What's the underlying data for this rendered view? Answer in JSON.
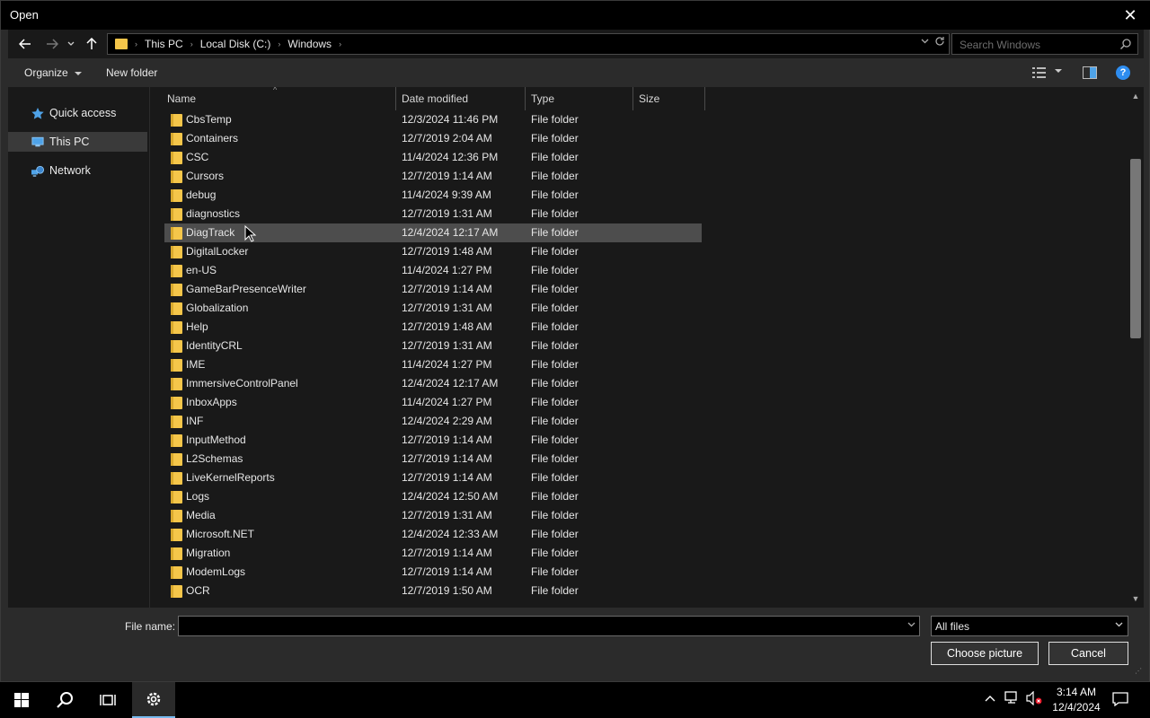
{
  "window": {
    "title": "Open",
    "close_glyph": "✕"
  },
  "navigation": {
    "back_glyph": "←",
    "forward_glyph": "→",
    "recent_glyph": "⌄",
    "up_glyph": "↑",
    "breadcrumbs": [
      "This PC",
      "Local Disk (C:)",
      "Windows"
    ],
    "search_placeholder": "Search Windows"
  },
  "toolbar": {
    "organize_label": "Organize",
    "new_folder_label": "New folder",
    "help_label": "?"
  },
  "sidebar": {
    "items": [
      {
        "label": "Quick access",
        "icon": "star-icon"
      },
      {
        "label": "This PC",
        "icon": "computer-icon",
        "selected": true
      },
      {
        "label": "Network",
        "icon": "network-icon"
      }
    ]
  },
  "file_list": {
    "columns": [
      "Name",
      "Date modified",
      "Type",
      "Size"
    ],
    "rows": [
      {
        "name": "CbsTemp",
        "date": "12/3/2024 11:46 PM",
        "type": "File folder"
      },
      {
        "name": "Containers",
        "date": "12/7/2019 2:04 AM",
        "type": "File folder"
      },
      {
        "name": "CSC",
        "date": "11/4/2024 12:36 PM",
        "type": "File folder"
      },
      {
        "name": "Cursors",
        "date": "12/7/2019 1:14 AM",
        "type": "File folder"
      },
      {
        "name": "debug",
        "date": "11/4/2024 9:39 AM",
        "type": "File folder"
      },
      {
        "name": "diagnostics",
        "date": "12/7/2019 1:31 AM",
        "type": "File folder"
      },
      {
        "name": "DiagTrack",
        "date": "12/4/2024 12:17 AM",
        "type": "File folder",
        "hover": true
      },
      {
        "name": "DigitalLocker",
        "date": "12/7/2019 1:48 AM",
        "type": "File folder"
      },
      {
        "name": "en-US",
        "date": "11/4/2024 1:27 PM",
        "type": "File folder"
      },
      {
        "name": "GameBarPresenceWriter",
        "date": "12/7/2019 1:14 AM",
        "type": "File folder"
      },
      {
        "name": "Globalization",
        "date": "12/7/2019 1:31 AM",
        "type": "File folder"
      },
      {
        "name": "Help",
        "date": "12/7/2019 1:48 AM",
        "type": "File folder"
      },
      {
        "name": "IdentityCRL",
        "date": "12/7/2019 1:31 AM",
        "type": "File folder"
      },
      {
        "name": "IME",
        "date": "11/4/2024 1:27 PM",
        "type": "File folder"
      },
      {
        "name": "ImmersiveControlPanel",
        "date": "12/4/2024 12:17 AM",
        "type": "File folder"
      },
      {
        "name": "InboxApps",
        "date": "11/4/2024 1:27 PM",
        "type": "File folder"
      },
      {
        "name": "INF",
        "date": "12/4/2024 2:29 AM",
        "type": "File folder"
      },
      {
        "name": "InputMethod",
        "date": "12/7/2019 1:14 AM",
        "type": "File folder"
      },
      {
        "name": "L2Schemas",
        "date": "12/7/2019 1:14 AM",
        "type": "File folder"
      },
      {
        "name": "LiveKernelReports",
        "date": "12/7/2019 1:14 AM",
        "type": "File folder"
      },
      {
        "name": "Logs",
        "date": "12/4/2024 12:50 AM",
        "type": "File folder"
      },
      {
        "name": "Media",
        "date": "12/7/2019 1:31 AM",
        "type": "File folder"
      },
      {
        "name": "Microsoft.NET",
        "date": "12/4/2024 12:33 AM",
        "type": "File folder"
      },
      {
        "name": "Migration",
        "date": "12/7/2019 1:14 AM",
        "type": "File folder"
      },
      {
        "name": "ModemLogs",
        "date": "12/7/2019 1:14 AM",
        "type": "File folder"
      },
      {
        "name": "OCR",
        "date": "12/7/2019 1:50 AM",
        "type": "File folder"
      }
    ]
  },
  "footer": {
    "file_name_label": "File name:",
    "file_name_value": "",
    "file_type": "All files",
    "primary_button": "Choose picture",
    "cancel_button": "Cancel"
  },
  "taskbar": {
    "time": "3:14 AM",
    "date": "12/4/2024"
  },
  "colors": {
    "folder": "#f5c64a",
    "accent": "#2e8df0",
    "background": "#191919"
  }
}
